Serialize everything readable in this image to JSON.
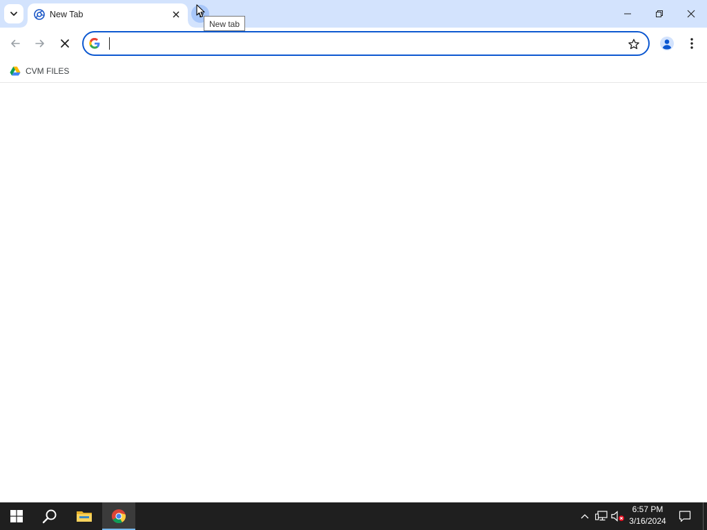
{
  "browser": {
    "tab": {
      "title": "New Tab"
    },
    "new_tab_tooltip": "New tab",
    "omnibox": {
      "value": "",
      "placeholder": ""
    },
    "bookmarks": [
      {
        "label": "CVM FILES",
        "icon": "google-drive-icon"
      }
    ],
    "colors": {
      "tabstrip": "#d3e3fd",
      "accent": "#0b57d0"
    }
  },
  "taskbar": {
    "clock": {
      "time": "6:57 PM",
      "date": "3/16/2024"
    },
    "pinned": [
      "start-icon",
      "search-icon",
      "file-explorer-icon",
      "chrome-icon"
    ],
    "tray": [
      "chevron-up-icon",
      "network-icon",
      "volume-muted-icon",
      "notifications-icon"
    ]
  }
}
